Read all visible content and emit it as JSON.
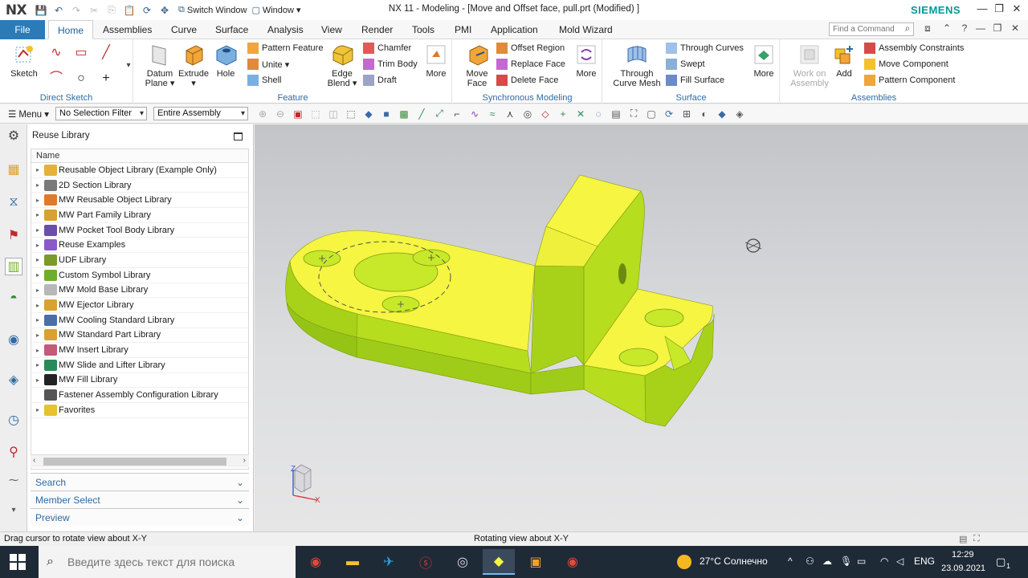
{
  "title_bar": {
    "logo": "NX",
    "switch_window": "Switch Window",
    "window_menu": "Window ▾",
    "title": "NX 11 - Modeling - [Move and Offset face, pull.prt (Modified) ]",
    "brand": "SIEMENS"
  },
  "tabs": [
    "File",
    "Home",
    "Assemblies",
    "Curve",
    "Surface",
    "Analysis",
    "View",
    "Render",
    "Tools",
    "PMI",
    "Application",
    "Mold Wizard"
  ],
  "find_command_placeholder": "Find a Command",
  "ribbon": {
    "direct_sketch": {
      "label": "Direct Sketch",
      "sketch": "Sketch"
    },
    "feature": {
      "label": "Feature",
      "datum_plane": "Datum Plane ▾",
      "extrude": "Extrude ▾",
      "hole": "Hole",
      "pattern_feature": "Pattern Feature",
      "unite": "Unite ▾",
      "shell": "Shell",
      "edge_blend": "Edge Blend ▾",
      "chamfer": "Chamfer",
      "trim_body": "Trim Body",
      "draft": "Draft",
      "more": "More"
    },
    "sync": {
      "label": "Synchronous Modeling",
      "move_face": "Move Face",
      "offset_region": "Offset Region",
      "replace_face": "Replace Face",
      "delete_face": "Delete Face",
      "more": "More"
    },
    "surface": {
      "label": "Surface",
      "through_curve_mesh": "Through Curve Mesh",
      "through_curves": "Through Curves",
      "swept": "Swept",
      "fill_surface": "Fill Surface",
      "more": "More"
    },
    "assemblies": {
      "label": "Assemblies",
      "work_on_assembly": "Work on Assembly",
      "add": "Add",
      "assembly_constraints": "Assembly Constraints",
      "move_component": "Move Component",
      "pattern_component": "Pattern Component"
    }
  },
  "toolbar2": {
    "menu": "Menu ▾",
    "selection_filter": "No Selection Filter",
    "scope": "Entire Assembly"
  },
  "panel": {
    "title": "Reuse Library",
    "column": "Name",
    "items": [
      {
        "label": "Reusable Object Library (Example Only)",
        "color": "#e2b23a"
      },
      {
        "label": "2D Section Library",
        "color": "#7a7a7a"
      },
      {
        "label": "MW Reusable Object Library",
        "color": "#e07a2a"
      },
      {
        "label": "MW Part Family Library",
        "color": "#d9a131"
      },
      {
        "label": "MW Pocket Tool Body Library",
        "color": "#6b4ea8"
      },
      {
        "label": "Reuse Examples",
        "color": "#8a5bc8"
      },
      {
        "label": "UDF Library",
        "color": "#7a9a2a"
      },
      {
        "label": "Custom Symbol Library",
        "color": "#6fae2c"
      },
      {
        "label": "MW Mold Base Library",
        "color": "#b7b7b7"
      },
      {
        "label": "MW Ejector Library",
        "color": "#d9a131"
      },
      {
        "label": "MW Cooling Standard Library",
        "color": "#4a6fa8"
      },
      {
        "label": "MW Standard Part Library",
        "color": "#d9a131"
      },
      {
        "label": "MW Insert Library",
        "color": "#c25a7a"
      },
      {
        "label": "MW Slide and Lifter Library",
        "color": "#2a8a5a"
      },
      {
        "label": "MW Fill Library",
        "color": "#222222"
      },
      {
        "label": "Fastener Assembly Configuration Library",
        "color": "#555555"
      },
      {
        "label": "Favorites",
        "color": "#e6c22e"
      }
    ],
    "sections": [
      "Search",
      "Member Select",
      "Preview"
    ]
  },
  "status": {
    "left": "Drag cursor to rotate view about X-Y",
    "middle": "Rotating view about X-Y"
  },
  "triad": {
    "x": "X",
    "z": "Z"
  },
  "taskbar": {
    "search_placeholder": "Введите здесь текст для поиска",
    "weather": "27°C  Солнечно",
    "lang": "ENG",
    "time": "12:29",
    "date": "23.09.2021",
    "notifications": "1"
  },
  "colors": {
    "accent": "#2b7bb9",
    "model_top": "#f5f542",
    "model_side": "#b6dd1e"
  }
}
